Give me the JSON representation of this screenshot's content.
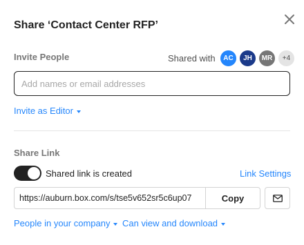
{
  "dialog": {
    "title": "Share ‘Contact Center RFP’"
  },
  "invite": {
    "section_label": "Invite People",
    "shared_with_label": "Shared with",
    "avatars": [
      {
        "initials": "AC",
        "color": "#2486fc"
      },
      {
        "initials": "JH",
        "color": "#1b3a8a"
      },
      {
        "initials": "MR",
        "color": "#767676"
      }
    ],
    "more_count": "+4",
    "more_color": "#e4e4e4",
    "input_placeholder": "Add names or email addresses",
    "input_value": "",
    "role_dropdown": "Invite as Editor"
  },
  "share_link": {
    "section_label": "Share Link",
    "toggle_on": true,
    "toggle_label": "Shared link is created",
    "settings_link": "Link Settings",
    "url": "https://auburn.box.com/s/tse5v652sr5c6up07",
    "copy_label": "Copy",
    "audience_dropdown": "People in your company",
    "permission_dropdown": "Can view and download"
  },
  "colors": {
    "accent": "#2486fc",
    "text": "#222222",
    "muted": "#767676"
  },
  "icons": {
    "close": "close-icon",
    "email": "envelope-icon",
    "dropdown": "caret-down-icon"
  }
}
